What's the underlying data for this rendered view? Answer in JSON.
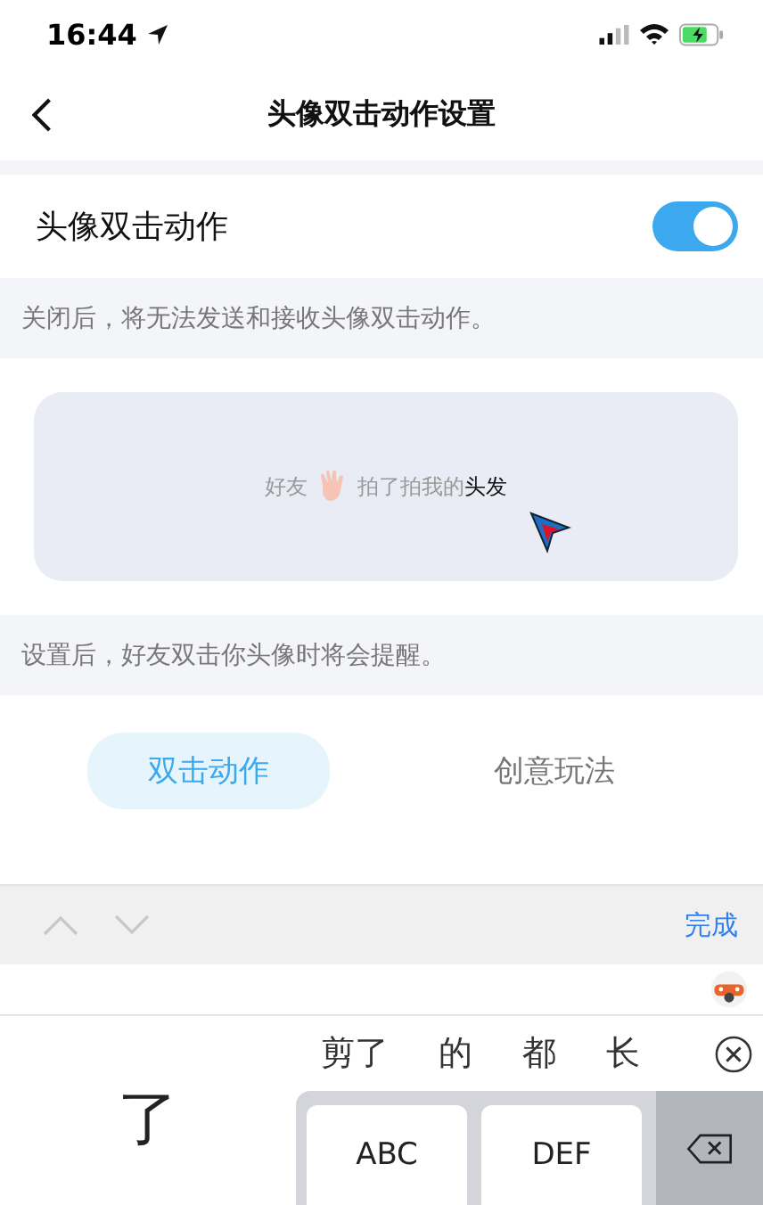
{
  "status_bar": {
    "time": "16:44"
  },
  "nav": {
    "title": "头像双击动作设置"
  },
  "setting": {
    "label": "头像双击动作",
    "on": true
  },
  "hint_off": "关闭后，将无法发送和接收头像双击动作。",
  "preview": {
    "before": "好友",
    "after": "拍了拍我的",
    "highlight": "头发"
  },
  "hint_on": "设置后，好友双击你头像时将会提醒。",
  "tabs": [
    {
      "label": "双击动作",
      "selected": true
    },
    {
      "label": "创意玩法",
      "selected": false
    }
  ],
  "toolbar": {
    "done": "完成"
  },
  "keyboard": {
    "composing": "了",
    "candidates": [
      "剪了",
      "的",
      "都",
      "长"
    ],
    "keys": [
      "ABC",
      "DEF"
    ]
  }
}
